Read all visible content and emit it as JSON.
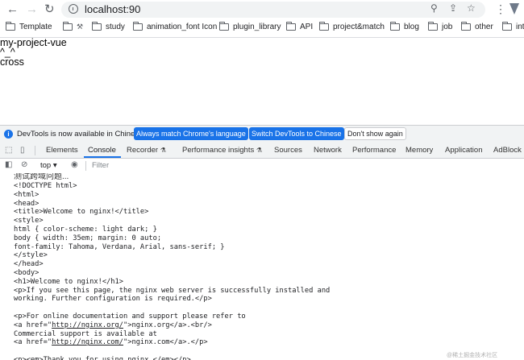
{
  "browser": {
    "url": "localhost:90",
    "bookmarks": [
      "Template",
      "study",
      "animation_font Icon",
      "plugin_library",
      "API",
      "project&match",
      "blog",
      "job",
      "other",
      "int"
    ]
  },
  "page": {
    "lines": [
      "my-project-vue",
      "^_^",
      "cross"
    ]
  },
  "devtools": {
    "notice": {
      "text": "DevTools is now available in Chinese!",
      "btn_match": "Always match Chrome's language",
      "btn_switch": "Switch DevTools to Chinese",
      "btn_dismiss": "Don't show again"
    },
    "tabs": [
      "Elements",
      "Console",
      "Recorder",
      "Performance insights",
      "Sources",
      "Network",
      "Performance",
      "Memory",
      "Application",
      "AdBlock"
    ],
    "active_tab": "Console",
    "context": "top",
    "filter_placeholder": "Filter",
    "log_cut": "测试跨域问题...",
    "log_lines": [
      "<!DOCTYPE html>",
      "<html>",
      "<head>",
      "<title>Welcome to nginx!</title>",
      "<style>",
      "html { color-scheme: light dark; }",
      "body { width: 35em; margin: 0 auto;",
      "font-family: Tahoma, Verdana, Arial, sans-serif; }",
      "</style>",
      "</head>",
      "<body>",
      "<h1>Welcome to nginx!</h1>",
      "<p>If you see this page, the nginx web server is successfully installed and",
      "working. Further configuration is required.</p>",
      "",
      "<p>For online documentation and support please refer to",
      "<a href=\"http://nginx.org/\">nginx.org</a>.<br/>",
      "Commercial support is available at",
      "<a href=\"http://nginx.com/\">nginx.com</a>.</p>",
      "",
      "<p><em>Thank you for using nginx.</em></p>",
      "</body>"
    ],
    "log_links": [
      "http://nginx.org/",
      "http://nginx.com/"
    ]
  },
  "watermark": "@稀土掘金技术社区"
}
